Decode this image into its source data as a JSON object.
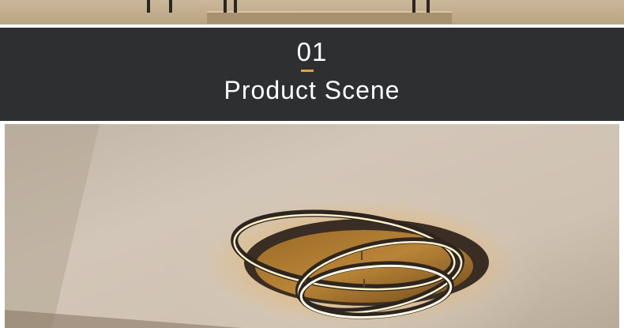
{
  "section": {
    "number": "01",
    "title": "Product Scene"
  },
  "colors": {
    "banner_bg": "#2e2f31",
    "accent": "#e0a33a",
    "text": "#ffffff"
  },
  "images": {
    "top_photo": "table-and-chairs-photo",
    "scene_photo": "ring-led-ceiling-lamp-photo"
  }
}
